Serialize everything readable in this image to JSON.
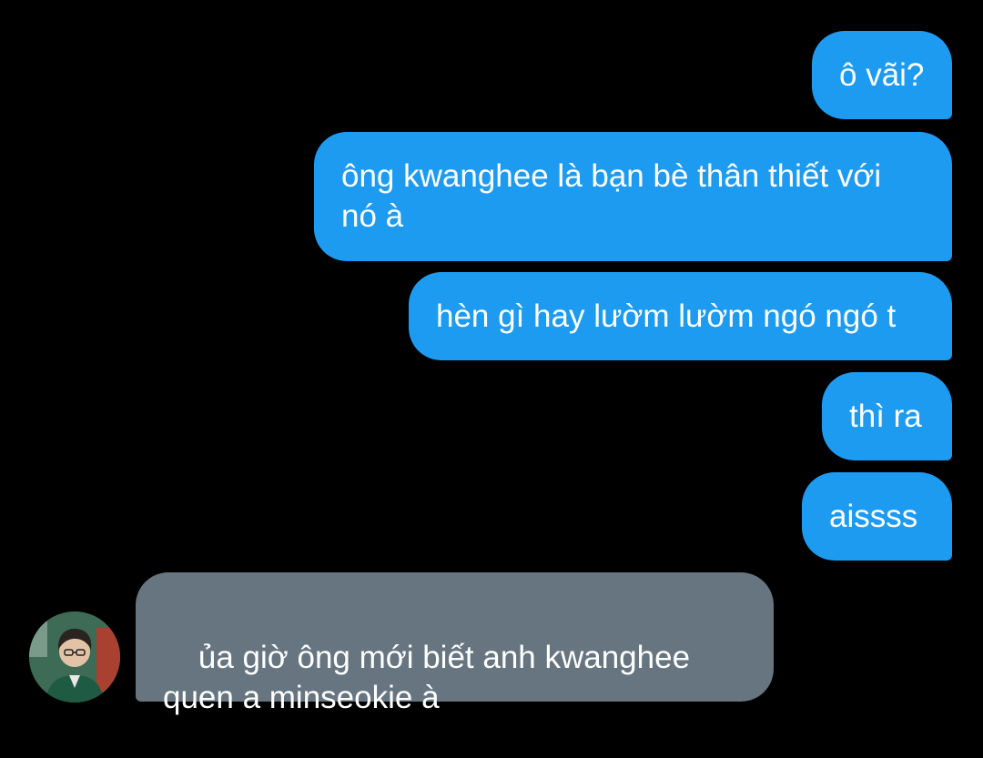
{
  "conversation": {
    "sent_messages": [
      "ô vãi?",
      "ông kwanghee là bạn bè thân thiết với nó à",
      "hèn gì hay lườm lườm ngó ngó t",
      "thì ra",
      "aissss"
    ],
    "received_message": "ủa giờ ông mới biết anh kwanghee quen a minseokie à"
  },
  "colors": {
    "background": "#000000",
    "sent_bubble": "#1d9bf0",
    "received_bubble": "#66757f",
    "text": "#ffffff"
  }
}
